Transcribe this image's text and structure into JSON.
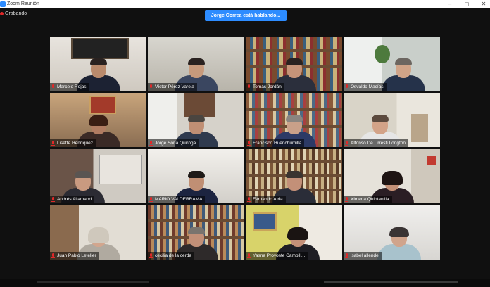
{
  "window": {
    "title": "Zoom Reunión",
    "controls": [
      "–",
      "◻",
      "✕"
    ]
  },
  "status": {
    "recording_label": "Grabando",
    "speaking_banner": "Jorge Correa está hablando..."
  },
  "participants": [
    {
      "name": "Marcelo Rojas"
    },
    {
      "name": "Víctor Pérez Varela"
    },
    {
      "name": "Tomás Jordán"
    },
    {
      "name": "Osvaldo Macías"
    },
    {
      "name": "Lisette Henríquez"
    },
    {
      "name": "Jorge Soria Quiroga"
    },
    {
      "name": "Francisco Huenchumilla"
    },
    {
      "name": "Alfonso De Urresti Longton"
    },
    {
      "name": "Andrés Allamand"
    },
    {
      "name": "MARIO VALDERRAMA"
    },
    {
      "name": "Fernando Atria"
    },
    {
      "name": "Ximena Quintanilla"
    },
    {
      "name": "Juan Pablo Letelier"
    },
    {
      "name": "cecilia de la cerda"
    },
    {
      "name": "Yasna Provoste Campill..."
    },
    {
      "name": "isabel allende"
    }
  ],
  "colors": {
    "accent": "#2d8cff",
    "mic_muted": "#e02828",
    "background": "#101010"
  }
}
